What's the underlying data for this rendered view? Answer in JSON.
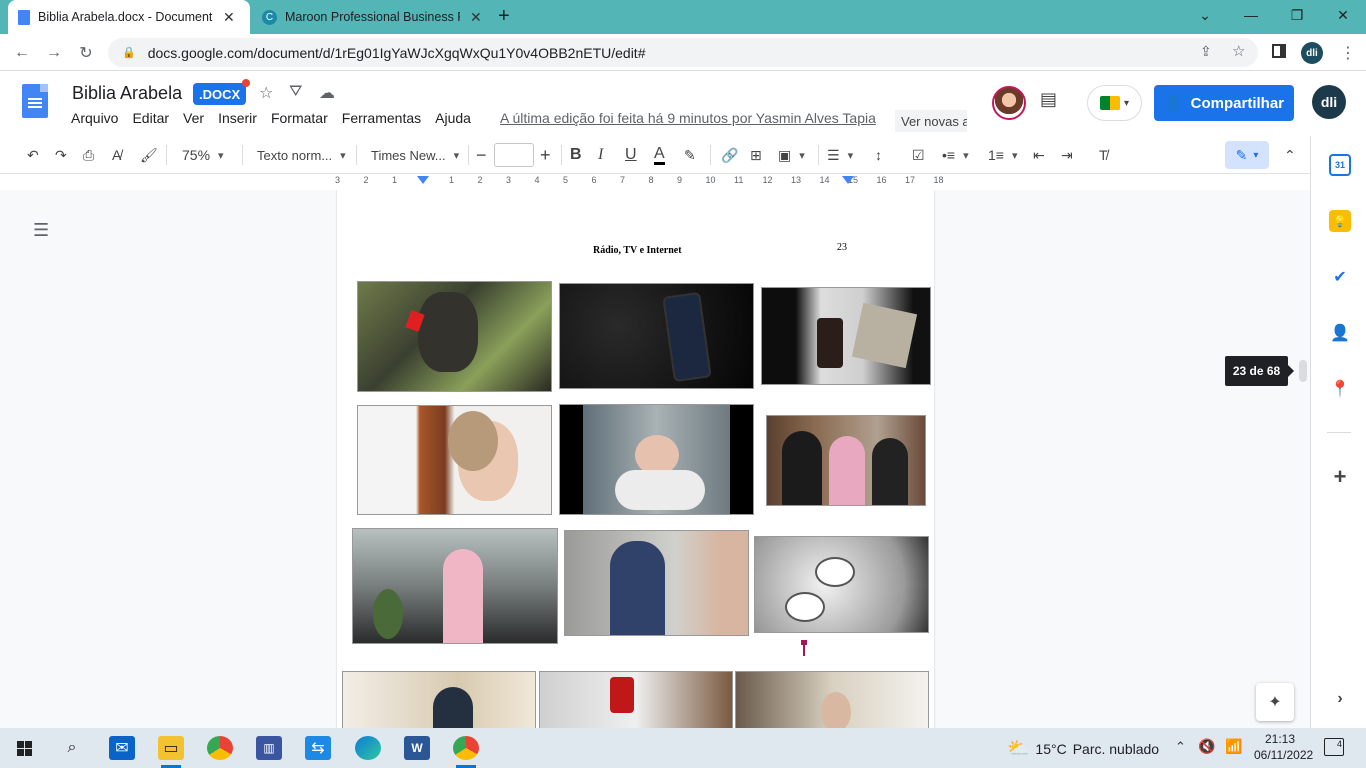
{
  "browser": {
    "tabs": [
      {
        "title": "Biblia Arabela.docx - Documento",
        "active": true
      },
      {
        "title": "Maroon Professional Business Pa",
        "active": false
      }
    ],
    "new_tab_label": "+",
    "url": "docs.google.com/document/d/1rEg01IgYaWJcXgqWxQu1Y0v4OBB2nETU/edit#",
    "profile_initials": "dli"
  },
  "doc": {
    "title": "Biblia Arabela",
    "badge": ".DOCX",
    "menus": [
      "Arquivo",
      "Editar",
      "Ver",
      "Inserir",
      "Formatar",
      "Ferramentas",
      "Ajuda"
    ],
    "last_edit": "A última edição foi feita há 9 minutos por Yasmin Alves Tapia",
    "new_changes": "Ver novas alterações",
    "share_label": "Compartilhar",
    "account_initials": "dli"
  },
  "toolbar": {
    "zoom": "75%",
    "style": "Texto norm...",
    "font": "Times New...",
    "font_size": ""
  },
  "ruler": {
    "ticks": [
      "3",
      "2",
      "1",
      "",
      "1",
      "2",
      "3",
      "4",
      "5",
      "6",
      "7",
      "8",
      "9",
      "10",
      "11",
      "12",
      "13",
      "14",
      "15",
      "16",
      "17",
      "18"
    ]
  },
  "page": {
    "heading": "Rádio, TV e Internet",
    "number": "23",
    "indicator": "23 de 68"
  },
  "taskbar": {
    "temperature": "15°C",
    "weather": "Parc. nublado",
    "time": "21:13",
    "date": "06/11/2022",
    "notifications": "4"
  },
  "colors": {
    "tabbar": "#53b5b6",
    "accent": "#1a73e8",
    "cursor": "#a0185b"
  }
}
